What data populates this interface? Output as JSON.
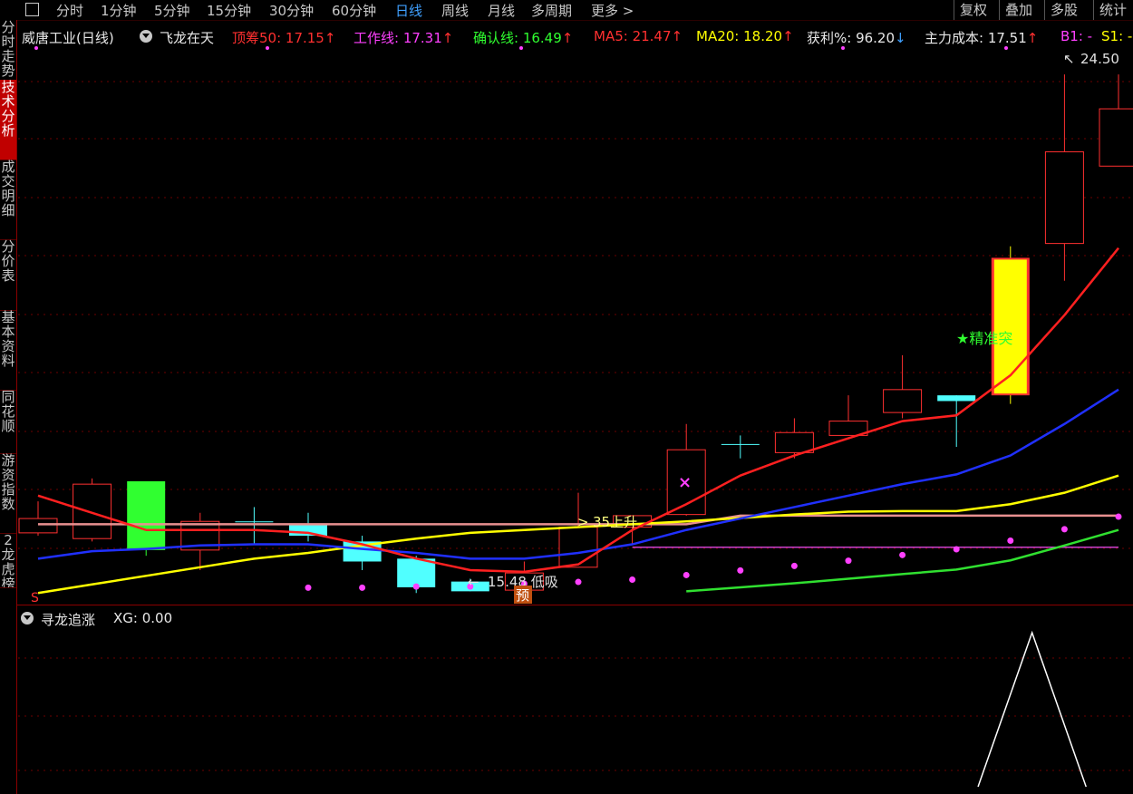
{
  "toolbar": {
    "periods": [
      "分时",
      "1分钟",
      "5分钟",
      "15分钟",
      "30分钟",
      "60分钟",
      "日线",
      "周线",
      "月线",
      "多周期",
      "更多 >"
    ],
    "active": "日线",
    "right": [
      "复权",
      "叠加",
      "多股",
      "统计"
    ]
  },
  "sidebar": {
    "tabs": [
      "分时走势",
      "技术分析",
      "成交明细",
      "分价表",
      "基本资料",
      "同花顺",
      "游资指数",
      "2龙虎榜"
    ],
    "active": "技术分析"
  },
  "header": {
    "stock": "威唐工业(日线)",
    "indicator": "飞龙在天",
    "items": [
      {
        "label": "顶筹50: 17.15",
        "arrow": "↑",
        "color": "#ff3030"
      },
      {
        "label": "工作线: 17.31",
        "arrow": "↑",
        "color": "#ff40ff"
      },
      {
        "label": "确认线: 16.49",
        "arrow": "↑",
        "color": "#30ff30"
      },
      {
        "label": "MA5: 21.47",
        "arrow": "↑",
        "color": "#ff3030"
      },
      {
        "label": "MA20: 18.20",
        "arrow": "↑",
        "color": "#ffff00"
      },
      {
        "label": "获利%: 96.20",
        "arrow": "↓",
        "color": "#e8e8e8"
      },
      {
        "label": "主力成本: 17.51",
        "arrow": "↑",
        "color": "#e8e8e8"
      },
      {
        "label": "B1: -",
        "arrow": "",
        "color": "#ff40ff"
      },
      {
        "label": "S1: -",
        "arrow": "",
        "color": "#ffff00"
      }
    ]
  },
  "annotations": {
    "high": "24.50",
    "low": "15.48 低吸",
    "buy_point": "35上升",
    "signal": "★精准突",
    "yu": "预",
    "s_mark": "S"
  },
  "sub": {
    "name": "寻龙追涨",
    "value": "XG: 0.00"
  },
  "chart_data": {
    "type": "candlestick",
    "candles": [
      {
        "o": 16.5,
        "c": 16.75,
        "h": 17.05,
        "l": 16.45,
        "color": "red"
      },
      {
        "o": 16.4,
        "c": 17.35,
        "h": 17.45,
        "l": 16.35,
        "color": "red"
      },
      {
        "o": 17.4,
        "c": 16.2,
        "h": 17.4,
        "l": 16.1,
        "color": "green"
      },
      {
        "o": 16.2,
        "c": 16.7,
        "h": 16.85,
        "l": 15.85,
        "color": "red"
      },
      {
        "o": 16.7,
        "c": 16.7,
        "h": 16.95,
        "l": 16.3,
        "color": "cyan"
      },
      {
        "o": 16.65,
        "c": 16.45,
        "h": 16.85,
        "l": 16.35,
        "color": "cyan"
      },
      {
        "o": 16.35,
        "c": 16.0,
        "h": 16.45,
        "l": 15.85,
        "color": "cyan"
      },
      {
        "o": 16.05,
        "c": 15.55,
        "h": 16.1,
        "l": 15.45,
        "color": "cyan"
      },
      {
        "o": 15.65,
        "c": 15.48,
        "h": 15.7,
        "l": 15.48,
        "color": "cyan"
      },
      {
        "o": 15.5,
        "c": 15.8,
        "h": 16.0,
        "l": 15.48,
        "color": "red"
      },
      {
        "o": 15.9,
        "c": 16.6,
        "h": 17.2,
        "l": 15.9,
        "color": "red"
      },
      {
        "o": 16.6,
        "c": 16.8,
        "h": 16.8,
        "l": 16.3,
        "color": "red"
      },
      {
        "o": 16.82,
        "c": 17.95,
        "h": 18.4,
        "l": 16.8,
        "color": "red"
      },
      {
        "o": 18.05,
        "c": 18.05,
        "h": 18.2,
        "l": 17.8,
        "color": "cyan"
      },
      {
        "o": 17.9,
        "c": 18.25,
        "h": 18.5,
        "l": 17.8,
        "color": "red"
      },
      {
        "o": 18.2,
        "c": 18.45,
        "h": 18.9,
        "l": 18.2,
        "color": "red"
      },
      {
        "o": 18.6,
        "c": 19.0,
        "h": 19.6,
        "l": 18.5,
        "color": "red"
      },
      {
        "o": 18.9,
        "c": 18.8,
        "h": 18.9,
        "l": 18.0,
        "color": "cyan"
      },
      {
        "o": 18.9,
        "c": 21.3,
        "h": 21.5,
        "l": 18.75,
        "color": "yellow"
      },
      {
        "o": 21.55,
        "c": 23.15,
        "h": 24.5,
        "l": 20.9,
        "color": "red"
      },
      {
        "o": 22.9,
        "c": 23.9,
        "h": 24.5,
        "l": 22.9,
        "color": "red"
      }
    ],
    "ma5": [
      17.15,
      16.85,
      16.55,
      16.55,
      16.55,
      16.5,
      16.3,
      16.05,
      15.85,
      15.82,
      15.95,
      16.55,
      17.0,
      17.5,
      17.85,
      18.15,
      18.45,
      18.55,
      19.25,
      20.3,
      21.47
    ],
    "ma20": [
      15.45,
      15.6,
      15.75,
      15.9,
      16.05,
      16.15,
      16.28,
      16.4,
      16.5,
      16.55,
      16.6,
      16.65,
      16.7,
      16.76,
      16.82,
      16.87,
      16.88,
      16.88,
      17.0,
      17.2,
      17.5
    ],
    "blue_line": [
      16.05,
      16.18,
      16.22,
      16.28,
      16.3,
      16.3,
      16.22,
      16.15,
      16.05,
      16.05,
      16.15,
      16.3,
      16.55,
      16.75,
      16.95,
      17.15,
      17.35,
      17.52,
      17.85,
      18.4,
      19.0
    ],
    "pink_line": [
      16.65,
      16.65,
      16.65,
      16.65,
      16.65,
      16.65,
      16.65,
      16.65,
      16.65,
      16.65,
      16.65,
      16.65,
      16.65,
      16.8,
      16.8,
      16.8,
      16.8,
      16.8,
      16.8,
      16.8,
      16.8
    ],
    "green_line": [
      null,
      null,
      null,
      null,
      null,
      null,
      null,
      null,
      null,
      null,
      null,
      null,
      15.48,
      15.55,
      15.62,
      15.7,
      15.78,
      15.86,
      16.02,
      16.28,
      16.55
    ],
    "purple_line": [
      null,
      null,
      null,
      null,
      null,
      null,
      null,
      null,
      null,
      null,
      null,
      16.25,
      16.25,
      16.25,
      16.25,
      16.25,
      16.25,
      16.25,
      16.25,
      16.25,
      16.25
    ],
    "dots": [
      null,
      null,
      null,
      null,
      null,
      15.48,
      15.48,
      15.5,
      15.5,
      15.55,
      15.58,
      15.62,
      15.7,
      15.78,
      15.86,
      15.95,
      16.05,
      16.15,
      16.3,
      16.5,
      16.72
    ],
    "ylim": [
      15.47,
      24.85
    ],
    "sub_type": "line",
    "sub_x": [
      17.4,
      18.4,
      19.4
    ],
    "sub_values": [
      0,
      1,
      0
    ]
  }
}
